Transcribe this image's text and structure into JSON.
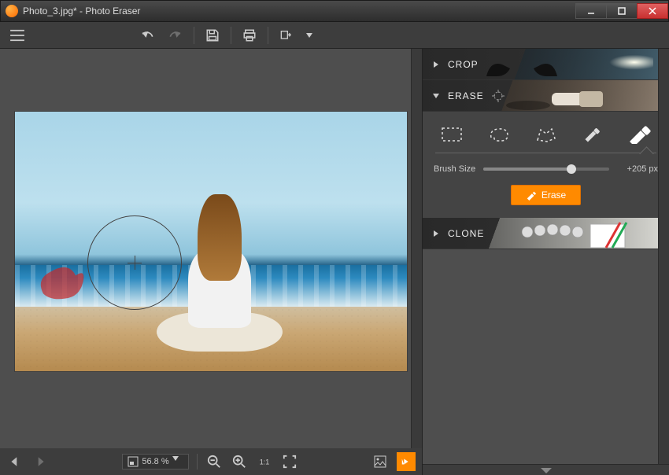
{
  "window": {
    "title": "Photo_3.jpg* - Photo Eraser"
  },
  "toolbar": {
    "undo": "undo",
    "redo": "redo",
    "save": "save",
    "print": "print",
    "export": "export"
  },
  "status": {
    "zoom_text": "56.8 %"
  },
  "sidebar": {
    "crop_label": "CROP",
    "erase_label": "ERASE",
    "clone_label": "CLONE"
  },
  "erase_panel": {
    "tools": [
      "rect-select",
      "lasso-select",
      "poly-select",
      "brush-small",
      "brush-large"
    ],
    "brush_label": "Brush Size",
    "brush_value": "+205 px",
    "erase_button": "Erase"
  }
}
